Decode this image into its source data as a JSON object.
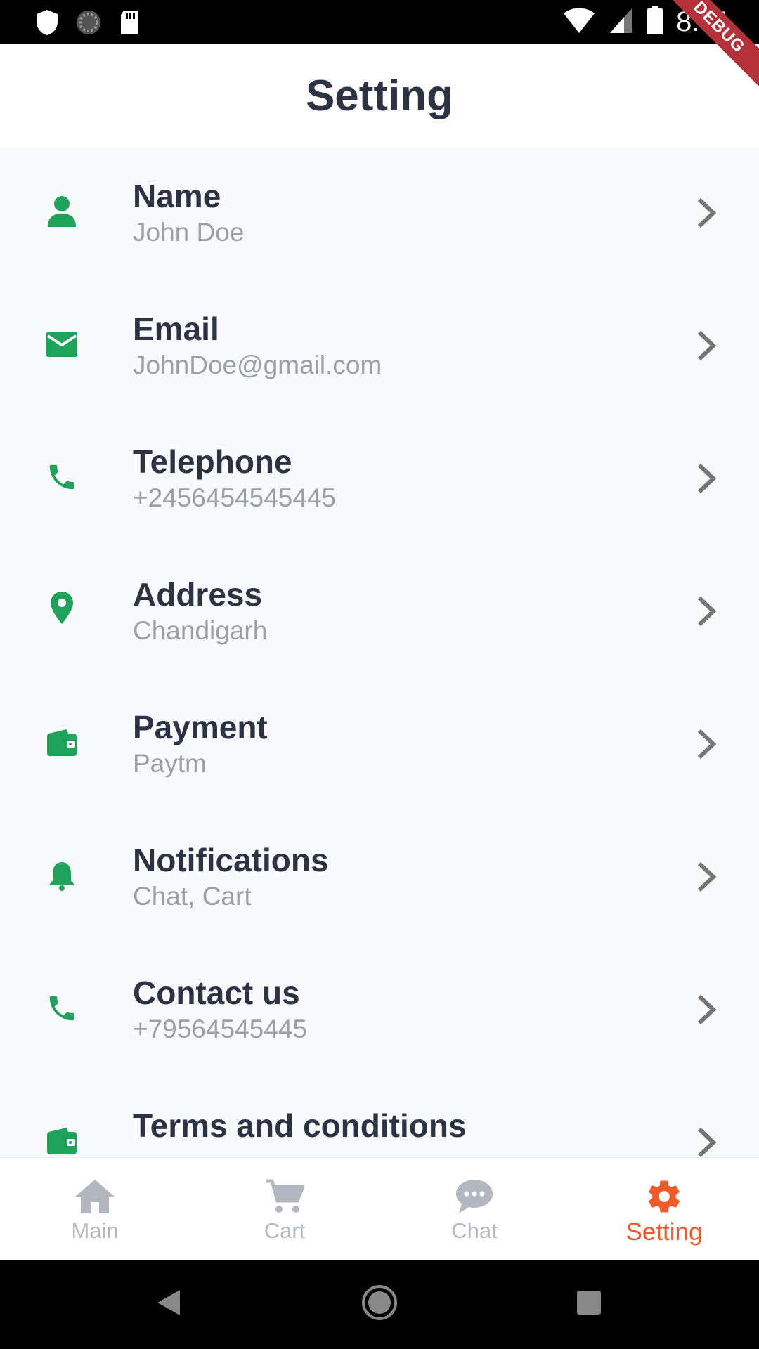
{
  "status_bar": {
    "time": "8:41",
    "left_icons": [
      "shield-icon",
      "loading-icon",
      "sd-card-icon"
    ],
    "right_icons": [
      "wifi-icon",
      "signal-icon",
      "battery-icon"
    ]
  },
  "debug_banner": "DEBUG",
  "app_bar": {
    "title": "Setting"
  },
  "settings": [
    {
      "label": "Name",
      "value": "John Doe",
      "icon": "person-icon"
    },
    {
      "label": "Email",
      "value": "JohnDoe@gmail.com",
      "icon": "mail-icon"
    },
    {
      "label": "Telephone",
      "value": "+2456454545445",
      "icon": "phone-icon"
    },
    {
      "label": "Address",
      "value": "Chandigarh",
      "icon": "location-pin-icon"
    },
    {
      "label": "Payment",
      "value": "Paytm",
      "icon": "wallet-icon"
    },
    {
      "label": "Notifications",
      "value": "Chat, Cart",
      "icon": "bell-icon"
    },
    {
      "label": "Contact us",
      "value": "+79564545445",
      "icon": "phone-icon"
    },
    {
      "label": "Terms and conditions",
      "value": "",
      "icon": "wallet-icon"
    }
  ],
  "bottom_nav": {
    "items": [
      {
        "label": "Main",
        "icon": "home-icon",
        "active": false
      },
      {
        "label": "Cart",
        "icon": "cart-icon",
        "active": false
      },
      {
        "label": "Chat",
        "icon": "chat-icon",
        "active": false
      },
      {
        "label": "Setting",
        "icon": "gear-icon",
        "active": true
      }
    ]
  },
  "colors": {
    "icon_green": "#1fa25a",
    "title_text": "#2c3344",
    "subtitle_text": "#9aa0a8",
    "active_nav": "#f05a2b",
    "inactive_nav": "#b3b8c0",
    "list_background": "#f8f9fa"
  }
}
